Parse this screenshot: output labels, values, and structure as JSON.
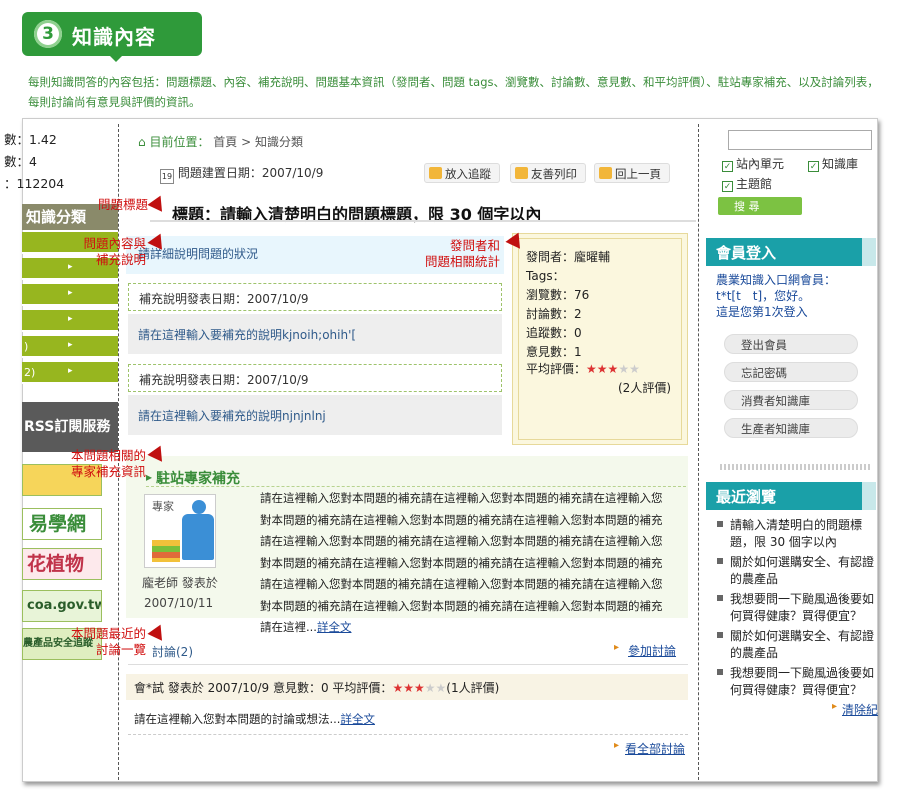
{
  "header": {
    "badge_number": "3",
    "title": "知識內容",
    "description": "每則知識問答的內容包括：問題標題、內容、補充說明、問題基本資訊（發問者、問題 tags、瀏覽數、討論數、意見數、和平均評價）、駐站專家補充、以及討論列表，每則討論尚有意見與評價的資訊。"
  },
  "left": {
    "stats": [
      "數：1.42",
      "數：4",
      "：112204"
    ],
    "category_header": "知識分類",
    "category_items": [
      "",
      "",
      "",
      "",
      ")",
      "2)"
    ],
    "rss": "RSS訂閱服務",
    "banners": [
      "",
      "易學網",
      "花植物園",
      "coa.gov.tw",
      "農產品安全追蹤"
    ]
  },
  "breadcrumb": {
    "here": "目前位置：",
    "home": "首頁",
    "sep": ">",
    "current": "知識分類"
  },
  "question": {
    "created_label": "問題建置日期：2007/10/9",
    "date_icon_text": "19",
    "buttons": {
      "track": "放入追蹤",
      "print": "友善列印",
      "back": "回上一頁"
    },
    "title": "標題：請輸入清楚明白的問題標題，限 30 個字以內",
    "content": "請詳細說明問題的狀況",
    "supplements": [
      {
        "date": "補充說明發表日期：2007/10/9",
        "text": "請在這裡輸入要補充的說明kjnoih;ohih'["
      },
      {
        "date": "補充說明發表日期：2007/10/9",
        "text": "請在這裡輸入要補充的說明njnjnlnj"
      }
    ]
  },
  "asker": {
    "asker": "發問者：龐曜輔",
    "tags": "Tags：",
    "views": "瀏覽數：76",
    "discussions": "討論數：2",
    "tracks": "追蹤數：0",
    "opinions": "意見數：1",
    "rating_label": "平均評價：",
    "rating": 3,
    "rating_max": 5,
    "rating_count": "(2人評價)"
  },
  "expert": {
    "title": "駐站專家補充",
    "tag": "專家",
    "name": "龐老師 發表於",
    "date": "2007/10/11",
    "text": "請在這裡輸入您對本問題的補充請在這裡輸入您對本問題的補充請在這裡輸入您對本問題的補充請在這裡輸入您對本問題的補充請在這裡輸入您對本問題的補充請在這裡輸入您對本問題的補充請在這裡輸入您對本問題的補充請在這裡輸入您對本問題的補充請在這裡輸入您對本問題的補充請在這裡輸入您對本問題的補充請在這裡輸入您對本問題的補充請在這裡輸入您對本問題的補充請在這裡輸入您對本問題的補充請在這裡輸入您對本問題的補充請在這裡輸入您對本問題的補充請在這裡...",
    "more": "詳全文"
  },
  "discussion": {
    "label": "討論(2)",
    "join": "參加討論",
    "post_meta": "會*試 發表於 2007/10/9 意見數：0 平均評價：",
    "post_rating": 3,
    "post_rating_count": "(1人評價)",
    "post_text": "請在這裡輸入您對本問題的討論或想法...",
    "post_more": "詳全文",
    "all": "看全部討論"
  },
  "annotations": {
    "title": "問題標題",
    "content": "問題內容與\n補充說明",
    "asker": "發問者和\n問題相關統計",
    "expert": "本問題相關的\n專家補充資訊",
    "discussion": "本問題最近的\n討論一覽"
  },
  "right": {
    "search_value": "",
    "checks": [
      {
        "label": "站內單元",
        "checked": true
      },
      {
        "label": "知識庫",
        "checked": true
      },
      {
        "label": "主題館",
        "checked": true
      }
    ],
    "search_button": "搜 尋",
    "member_title": "會員登入",
    "member_line1": "農業知識入口網會員：",
    "member_line2": "t*t[t　t]，您好。",
    "member_line3": "這是您第1次登入",
    "member_buttons": [
      "登出會員",
      "忘記密碼",
      "消費者知識庫",
      "生產者知識庫"
    ],
    "recent_title": "最近瀏覽",
    "recent": [
      "請輸入清楚明白的問題標題，限 30 個字以內",
      "關於如何選購安全、有認證的農產品",
      "我想要問一下颱風過後要如何買得健康？買得便宜？",
      "關於如何選購安全、有認證的農產品",
      "我想要問一下颱風過後要如何買得健康？買得便宜？"
    ],
    "clear": "清除紀"
  }
}
